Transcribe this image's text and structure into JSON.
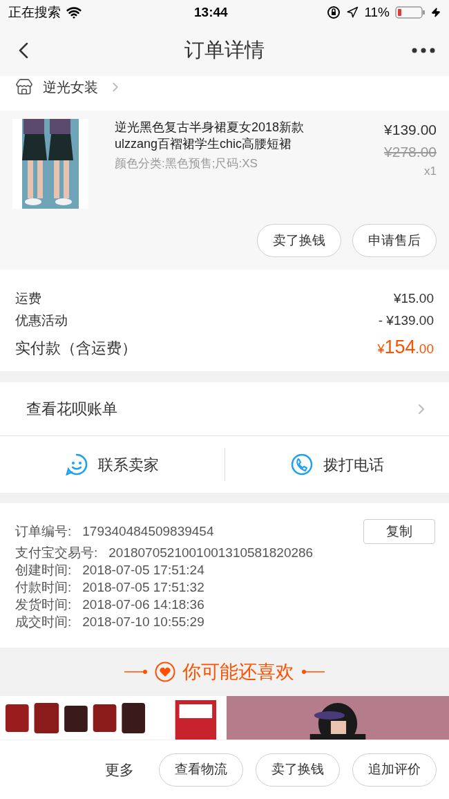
{
  "status_bar": {
    "carrier": "正在搜索",
    "time": "13:44",
    "battery": "11%"
  },
  "nav": {
    "title": "订单详情"
  },
  "store": {
    "name": "逆光女装"
  },
  "product": {
    "title": "逆光黑色复古半身裙夏女2018新款ulzzang百褶裙学生chic高腰短裙",
    "spec": "颜色分类:黑色预售;尺码:XS",
    "price": "¥139.00",
    "original_price": "¥278.00",
    "quantity": "x1",
    "kind": "picture",
    "actions": [
      "卖了换钱",
      "申请售后"
    ]
  },
  "fees": [
    {
      "label": "运费",
      "value": "¥15.00"
    },
    {
      "label": "优惠活动",
      "value": "- ¥139.00"
    }
  ],
  "total": {
    "label": "实付款（含运费）",
    "currency": "¥",
    "integer": "154",
    "decimals": ".00"
  },
  "huabei": {
    "label": "查看花呗账单"
  },
  "contact": [
    {
      "kind": "chat",
      "label": "联系卖家"
    },
    {
      "kind": "phone",
      "label": "拨打电话"
    }
  ],
  "order_info": {
    "copy_button": "复制",
    "rows": [
      {
        "label": "订单编号:",
        "value": "179340484509839454"
      },
      {
        "label": "支付宝交易号:",
        "value": "2018070521001001310581820286"
      },
      {
        "label": "创建时间:",
        "value": "2018-07-05 17:51:24"
      },
      {
        "label": "付款时间:",
        "value": "2018-07-05 17:51:32"
      },
      {
        "label": "发货时间:",
        "value": "2018-07-06 14:18:36"
      },
      {
        "label": "成交时间:",
        "value": "2018-07-10 10:55:29"
      }
    ]
  },
  "recommend": {
    "title": "你可能还喜欢"
  },
  "bottom_bar": {
    "more": "更多",
    "buttons": [
      "查看物流",
      "卖了换钱",
      "追加评价"
    ]
  }
}
